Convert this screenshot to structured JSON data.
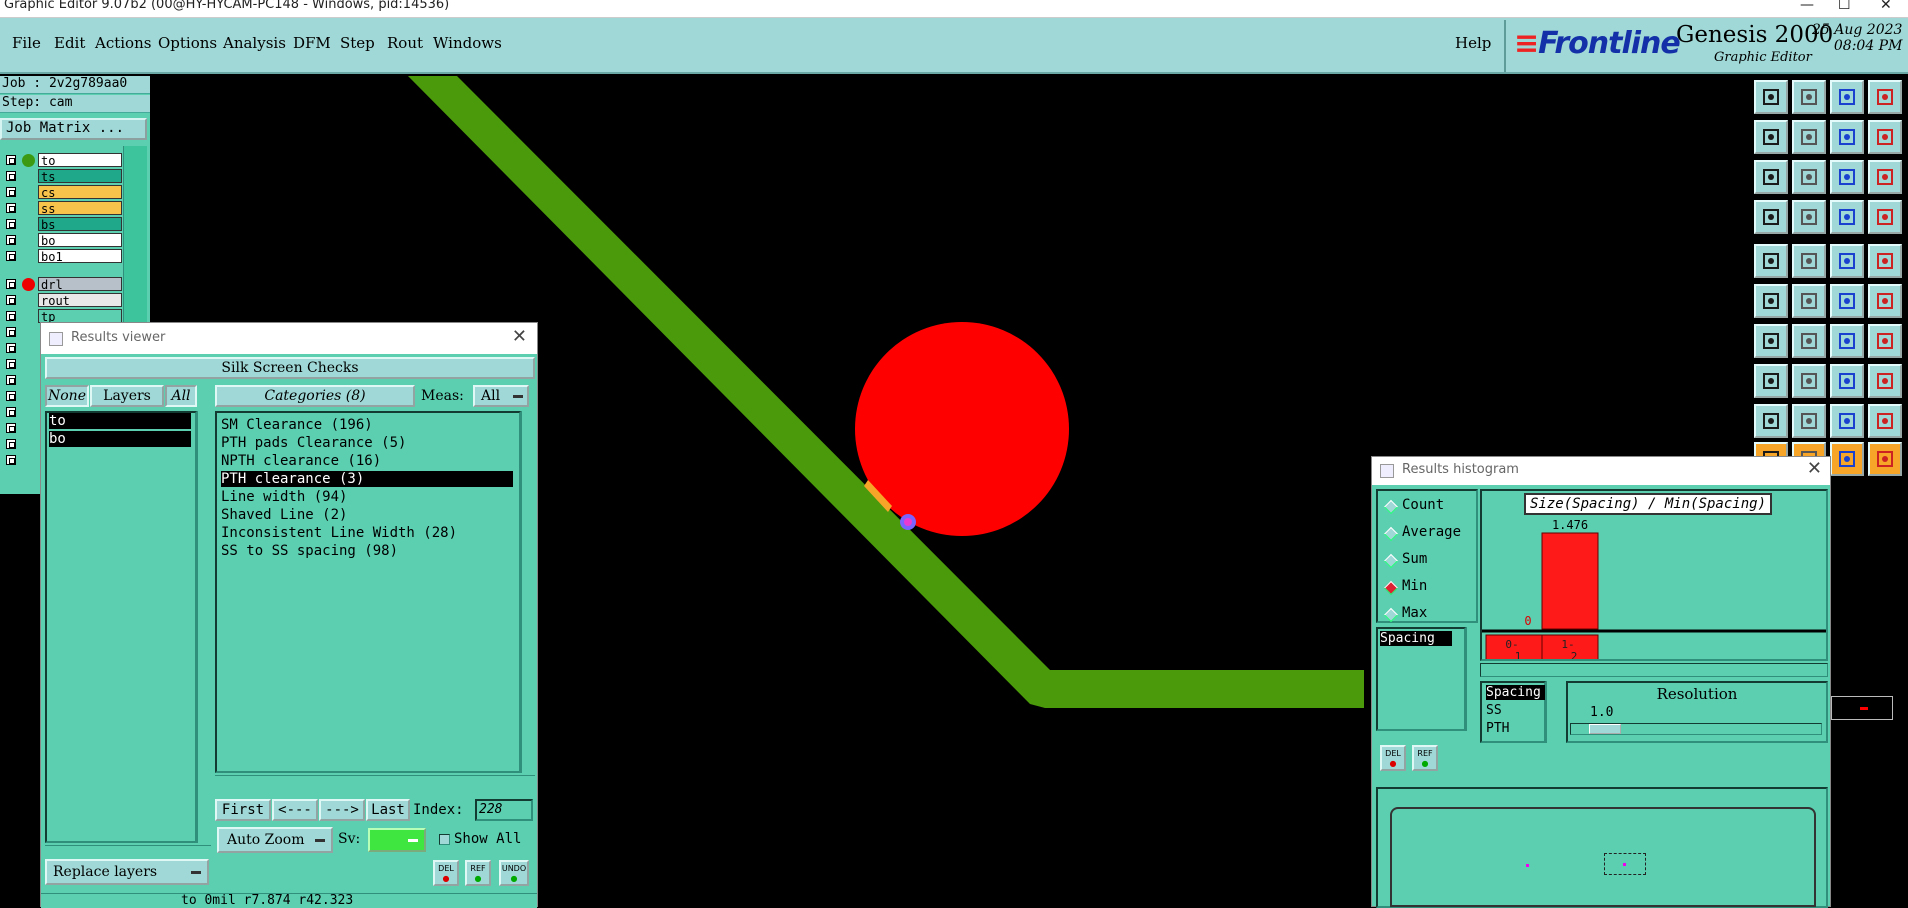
{
  "window": {
    "title": "Graphic Editor 9.07b2 (00@HY-HYCAM-PC148 - Windows, pid:14536)",
    "controls": [
      "—",
      "☐",
      "✕"
    ]
  },
  "menu": {
    "items": [
      "File",
      "Edit",
      "Actions",
      "Options",
      "Analysis",
      "DFM",
      "Step",
      "Rout",
      "Windows"
    ],
    "help": "Help"
  },
  "brand": {
    "logo": "Frontline",
    "product": "Genesis 2000",
    "subtitle": "Graphic Editor",
    "date": "25 Aug 2023",
    "time": "08:04 PM"
  },
  "job": {
    "job_label": "Job : 2v2g789aa0",
    "step_label": "Step: cam",
    "matrix_button": "Job Matrix ...",
    "layers": [
      {
        "name": "to",
        "bg": "#ffffff",
        "dot": "#3c9a12"
      },
      {
        "name": "ts",
        "bg": "#1fa88a",
        "dot": ""
      },
      {
        "name": "cs",
        "bg": "#f7c34a",
        "dot": ""
      },
      {
        "name": "ss",
        "bg": "#f7c34a",
        "dot": ""
      },
      {
        "name": "bs",
        "bg": "#1fa88a",
        "dot": ""
      },
      {
        "name": "bo",
        "bg": "#ffffff",
        "dot": ""
      },
      {
        "name": "bo1",
        "bg": "#ffffff",
        "dot": ""
      },
      {
        "name": "drl",
        "bg": "#b7c0c8",
        "dot": "#e00"
      },
      {
        "name": "rout",
        "bg": "#e8e8e8",
        "dot": ""
      },
      {
        "name": "tp",
        "bg": "#5ccfb1",
        "dot": ""
      }
    ]
  },
  "results_viewer": {
    "title": "Results viewer",
    "heading": "Silk Screen Checks",
    "none_btn": "None",
    "layers_btn": "Layers",
    "all_btn": "All",
    "categories_btn": "Categories (8)",
    "meas_label": "Meas:",
    "meas_value": "All",
    "layer_items": [
      "to",
      "bo"
    ],
    "categories": [
      "SM Clearance (196)",
      "PTH pads Clearance (5)",
      "NPTH clearance (16)",
      "PTH clearance (3)",
      "Line width (94)",
      "Shaved Line (2)",
      "Inconsistent Line Width (28)",
      "SS to SS spacing (98)"
    ],
    "selected_category": 3,
    "first_btn": "First",
    "prev_btn": "<---",
    "next_btn": "--->",
    "last_btn": "Last",
    "index_label": "Index:",
    "index_value": "228",
    "auto_zoom": "Auto Zoom",
    "sv_label": "Sv:",
    "show_all": "Show All",
    "replace_layers": "Replace layers",
    "del_label": "DEL",
    "ref_label": "REF",
    "undo_label": "UNDO",
    "status_text": "to 0mil r7.874 r42.323"
  },
  "histogram": {
    "title": "Results histogram",
    "modes": [
      "Count",
      "Average",
      "Sum",
      "Min",
      "Max"
    ],
    "selected_mode": 3,
    "chart_title": "Size(Spacing) / Min(Spacing)",
    "list_items": [
      "Spacing"
    ],
    "bins": [
      {
        "label": "0-\n1",
        "value": 0,
        "value_label": "0"
      },
      {
        "label": "1-\n2",
        "value": 1.476,
        "value_label": "1.476"
      }
    ],
    "lower_list": [
      "Spacing",
      "SS",
      "PTH"
    ],
    "resolution_label": "Resolution",
    "resolution_value": "1.0",
    "del_label": "DEL",
    "ref_label": "REF"
  },
  "colors": {
    "panel": "#5ccfb1",
    "light": "#9fd8d6",
    "trace": "#4a9a0b",
    "pad": "#ff0000"
  }
}
